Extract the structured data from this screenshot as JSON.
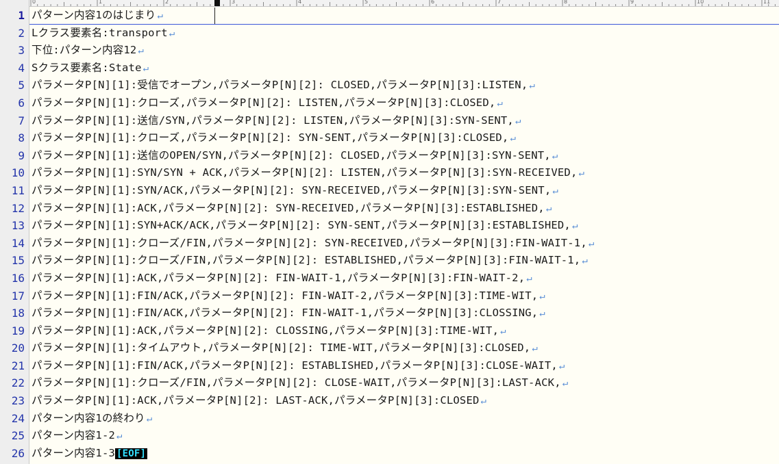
{
  "editor": {
    "ruler_labels": [
      "0",
      "1",
      "2",
      "3",
      "4",
      "5",
      "6",
      "7",
      "8",
      "9",
      "10",
      "11",
      "12",
      "13",
      "14",
      "15",
      "16",
      "17",
      "18",
      "19",
      "20",
      "21",
      "22",
      "23",
      "24",
      "25",
      "26",
      "27",
      "28",
      "29"
    ],
    "eol_mark": "↵",
    "eof_label": "[EOF]",
    "lines": [
      {
        "num": "1",
        "text": "パターン内容1のはじまり",
        "eol": true
      },
      {
        "num": "2",
        "text": "Lクラス要素名:transport",
        "eol": true
      },
      {
        "num": "3",
        "text": "下位:パターン内容12",
        "eol": true
      },
      {
        "num": "4",
        "text": "Sクラス要素名:State",
        "eol": true
      },
      {
        "num": "5",
        "text": "パラメータP[N][1]:受信でオープン,パラメータP[N][2]: CLOSED,パラメータP[N][3]:LISTEN,",
        "eol": true
      },
      {
        "num": "6",
        "text": "パラメータP[N][1]:クローズ,パラメータP[N][2]: LISTEN,パラメータP[N][3]:CLOSED,",
        "eol": true
      },
      {
        "num": "7",
        "text": "パラメータP[N][1]:送信/SYN,パラメータP[N][2]: LISTEN,パラメータP[N][3]:SYN-SENT,",
        "eol": true
      },
      {
        "num": "8",
        "text": "パラメータP[N][1]:クローズ,パラメータP[N][2]: SYN-SENT,パラメータP[N][3]:CLOSED,",
        "eol": true
      },
      {
        "num": "9",
        "text": "パラメータP[N][1]:送信のOPEN/SYN,パラメータP[N][2]: CLOSED,パラメータP[N][3]:SYN-SENT,",
        "eol": true
      },
      {
        "num": "10",
        "text": "パラメータP[N][1]:SYN/SYN + ACK,パラメータP[N][2]: LISTEN,パラメータP[N][3]:SYN-RECEIVED,",
        "eol": true
      },
      {
        "num": "11",
        "text": "パラメータP[N][1]:SYN/ACK,パラメータP[N][2]: SYN-RECEIVED,パラメータP[N][3]:SYN-SENT,",
        "eol": true
      },
      {
        "num": "12",
        "text": "パラメータP[N][1]:ACK,パラメータP[N][2]: SYN-RECEIVED,パラメータP[N][3]:ESTABLISHED,",
        "eol": true
      },
      {
        "num": "13",
        "text": "パラメータP[N][1]:SYN+ACK/ACK,パラメータP[N][2]: SYN-SENT,パラメータP[N][3]:ESTABLISHED,",
        "eol": true
      },
      {
        "num": "14",
        "text": "パラメータP[N][1]:クローズ/FIN,パラメータP[N][2]: SYN-RECEIVED,パラメータP[N][3]:FIN-WAIT-1,",
        "eol": true
      },
      {
        "num": "15",
        "text": "パラメータP[N][1]:クローズ/FIN,パラメータP[N][2]: ESTABLISHED,パラメータP[N][3]:FIN-WAIT-1,",
        "eol": true
      },
      {
        "num": "16",
        "text": "パラメータP[N][1]:ACK,パラメータP[N][2]: FIN-WAIT-1,パラメータP[N][3]:FIN-WAIT-2,",
        "eol": true
      },
      {
        "num": "17",
        "text": "パラメータP[N][1]:FIN/ACK,パラメータP[N][2]: FIN-WAIT-2,パラメータP[N][3]:TIME-WIT,",
        "eol": true
      },
      {
        "num": "18",
        "text": "パラメータP[N][1]:FIN/ACK,パラメータP[N][2]: FIN-WAIT-1,パラメータP[N][3]:CLOSSING,",
        "eol": true
      },
      {
        "num": "19",
        "text": "パラメータP[N][1]:ACK,パラメータP[N][2]: CLOSSING,パラメータP[N][3]:TIME-WIT,",
        "eol": true
      },
      {
        "num": "20",
        "text": "パラメータP[N][1]:タイムアウト,パラメータP[N][2]: TIME-WIT,パラメータP[N][3]:CLOSED,",
        "eol": true
      },
      {
        "num": "21",
        "text": "パラメータP[N][1]:FIN/ACK,パラメータP[N][2]: ESTABLISHED,パラメータP[N][3]:CLOSE-WAIT,",
        "eol": true
      },
      {
        "num": "22",
        "text": "パラメータP[N][1]:クローズ/FIN,パラメータP[N][2]: CLOSE-WAIT,パラメータP[N][3]:LAST-ACK,",
        "eol": true
      },
      {
        "num": "23",
        "text": "パラメータP[N][1]:ACK,パラメータP[N][2]: LAST-ACK,パラメータP[N][3]:CLOSED",
        "eol": true
      },
      {
        "num": "24",
        "text": "パターン内容1の終わり",
        "eol": true
      },
      {
        "num": "25",
        "text": "パターン内容1-2",
        "eol": true
      },
      {
        "num": "26",
        "text": "パターン内容1-3",
        "eol": false,
        "eof": true
      }
    ]
  },
  "colors": {
    "background": "#fffef5",
    "line_number": "#2233aa",
    "eol_mark": "#5b8fd6",
    "eof_bg": "#000000",
    "eof_fg": "#33e0ff",
    "current_line_underline": "#3a55d8"
  }
}
